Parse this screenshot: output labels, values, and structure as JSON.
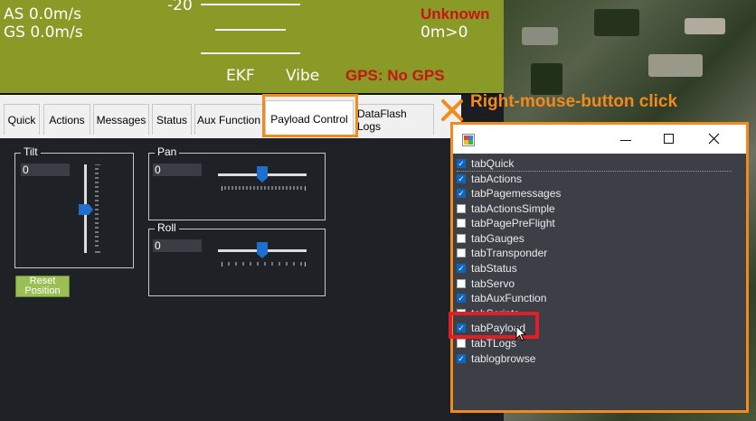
{
  "hud": {
    "airspeed": "AS 0.0m/s",
    "groundspeed": "GS 0.0m/s",
    "heading_tick": "-20",
    "mode": "Unknown",
    "distance": "0m>0",
    "ekf": "EKF",
    "vibe": "Vibe",
    "gps": "GPS: No GPS"
  },
  "tabs": [
    {
      "label": "Quick"
    },
    {
      "label": "Actions"
    },
    {
      "label": "Messages"
    },
    {
      "label": "Status"
    },
    {
      "label": "Aux Function"
    },
    {
      "label": "Payload Control",
      "selected": true
    },
    {
      "label": "DataFlash Logs"
    }
  ],
  "payload": {
    "tilt": {
      "label": "Tilt",
      "value": "0"
    },
    "pan": {
      "label": "Pan",
      "value": "0"
    },
    "roll": {
      "label": "Roll",
      "value": "0"
    },
    "reset_button": "Reset Position"
  },
  "annotation": {
    "text": "Right-mouse-button click",
    "color": "#f28a1e"
  },
  "popup": {
    "items": [
      {
        "label": "tabQuick",
        "checked": true
      },
      {
        "label": "tabActions",
        "checked": true
      },
      {
        "label": "tabPagemessages",
        "checked": true
      },
      {
        "label": "tabActionsSimple",
        "checked": false
      },
      {
        "label": "tabPagePreFlight",
        "checked": false
      },
      {
        "label": "tabGauges",
        "checked": false
      },
      {
        "label": "tabTransponder",
        "checked": false
      },
      {
        "label": "tabStatus",
        "checked": true
      },
      {
        "label": "tabServo",
        "checked": false
      },
      {
        "label": "tabAuxFunction",
        "checked": true
      },
      {
        "label": "tabScripts",
        "checked": false
      },
      {
        "label": "tabPayload",
        "checked": true
      },
      {
        "label": "tabTLogs",
        "checked": false
      },
      {
        "label": "tablogbrowse",
        "checked": true
      }
    ],
    "highlight_color": "#e01e26"
  },
  "colors": {
    "hud_background": "#8a9a26",
    "warning_red": "#c81414",
    "panel_background": "#1e2126",
    "accent_blue": "#1f6fd1"
  }
}
